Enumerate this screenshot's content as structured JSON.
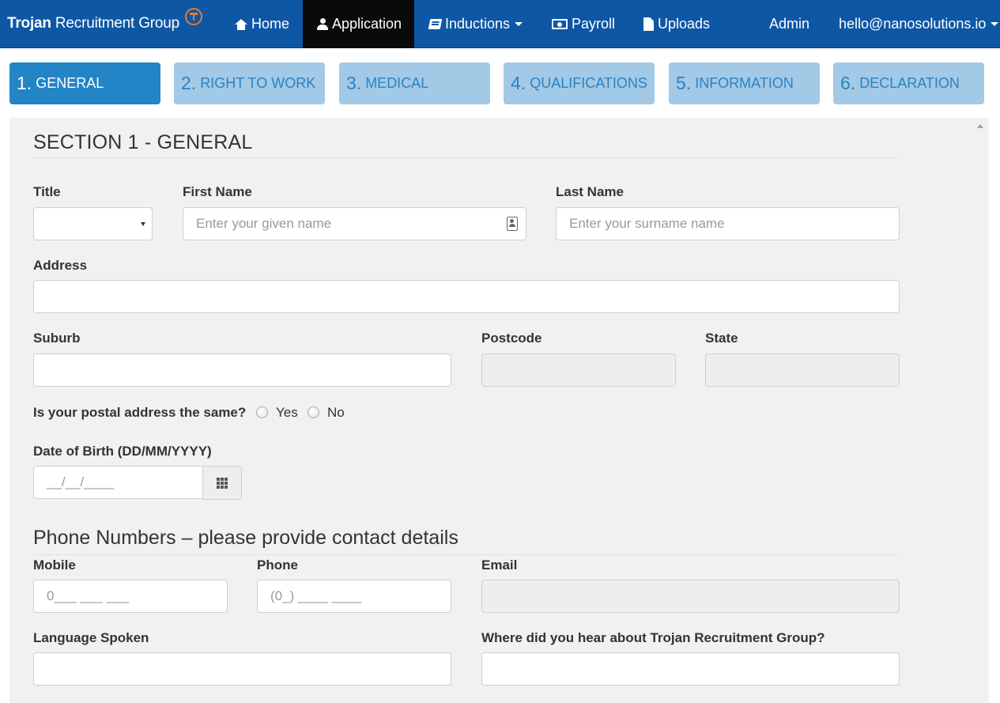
{
  "brand": {
    "name_bold": "Trojan",
    "name_rest": "Recruitment Group"
  },
  "nav": {
    "home": "Home",
    "application": "Application",
    "inductions": "Inductions",
    "payroll": "Payroll",
    "uploads": "Uploads",
    "admin": "Admin",
    "user_email": "hello@nanosolutions.io"
  },
  "steps": [
    {
      "num": "1.",
      "label": "GENERAL",
      "active": true
    },
    {
      "num": "2.",
      "label": "RIGHT TO WORK",
      "active": false
    },
    {
      "num": "3.",
      "label": "MEDICAL",
      "active": false
    },
    {
      "num": "4.",
      "label": "QUALIFICATIONS",
      "active": false
    },
    {
      "num": "5.",
      "label": "INFORMATION",
      "active": false
    },
    {
      "num": "6.",
      "label": "DECLARATION",
      "active": false
    }
  ],
  "section": {
    "title": "SECTION 1 - GENERAL",
    "fields": {
      "title_label": "Title",
      "title_value": "",
      "first_name_label": "First Name",
      "first_name_placeholder": "Enter your given name",
      "last_name_label": "Last Name",
      "last_name_placeholder": "Enter your surname name",
      "address_label": "Address",
      "suburb_label": "Suburb",
      "postcode_label": "Postcode",
      "state_label": "State",
      "postal_same_label": "Is your postal address the same?",
      "postal_yes": "Yes",
      "postal_no": "No",
      "dob_label": "Date of Birth (DD/MM/YYYY)",
      "dob_mask": "__/__/____"
    }
  },
  "phone_section": {
    "title": "Phone Numbers – please provide contact details",
    "mobile_label": "Mobile",
    "mobile_mask": "0___ ___ ___",
    "phone_label": "Phone",
    "phone_mask": "(0_) ____ ____",
    "email_label": "Email",
    "email_value": "",
    "language_label": "Language Spoken",
    "hear_label": "Where did you hear about Trojan Recruitment Group?"
  },
  "colors": {
    "navbar": "#0e57a5",
    "nav_active": "#0a0a0a",
    "step_active": "#2384c6",
    "step_inactive": "#a2c9e5",
    "step_text": "#2a82c4",
    "logo_accent": "#e8792e",
    "panel_bg": "#f1f1f1"
  },
  "icons": {
    "home": "home-icon",
    "application": "user-icon",
    "inductions": "book-icon",
    "payroll": "money-icon",
    "uploads": "file-icon",
    "contact": "contact-card-icon",
    "calendar": "calendar-grid-icon"
  }
}
